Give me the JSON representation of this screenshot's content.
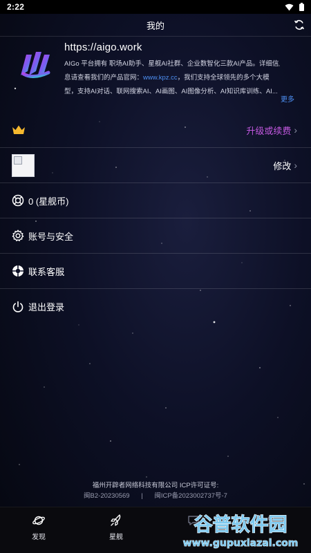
{
  "status_bar": {
    "time": "2:22"
  },
  "header": {
    "title": "我的"
  },
  "app": {
    "url": "https://aigo.work",
    "desc_line1": "AIGo 平台拥有 职场AI助手、星舰AI社群、企业数智化三款AI产品。详细信",
    "desc_line2_pre": "息请查看我们的产品官网：",
    "desc_link": "www.kpz.cc",
    "desc_line2_post": "，我们支持全球领先的多个大模",
    "desc_line3": "型，支持AI对话、联网搜索AI、AI画图、AI图像分析、AI知识库训练、AI...",
    "more": "更多"
  },
  "rows": {
    "upgrade": {
      "label": "升级或续费"
    },
    "avatar": {
      "action": "修改"
    },
    "coins": {
      "label": "0 (星舰币)"
    },
    "account": {
      "label": "账号与安全"
    },
    "support": {
      "label": "联系客服"
    },
    "logout": {
      "label": "退出登录"
    }
  },
  "footer": {
    "company": "福州开辟者网络科技有限公司 ICP许可证号:",
    "icp1": "闽B2-20230569",
    "separator": "|",
    "icp2": "闽ICP备2023002737号-7"
  },
  "bottom_nav": [
    {
      "label": "发现",
      "icon": "planet-icon"
    },
    {
      "label": "星舰",
      "icon": "rocket-icon"
    },
    {
      "label": "",
      "icon": "chat-icon"
    },
    {
      "label": "",
      "icon": "user-icon"
    }
  ],
  "watermark": {
    "text": "谷普软件园",
    "url": "www.gupuxlazal.com"
  },
  "colors": {
    "accent_purple": "#c158de",
    "link_blue": "#4d8ff2",
    "crown_gold": "#f5b82e"
  }
}
